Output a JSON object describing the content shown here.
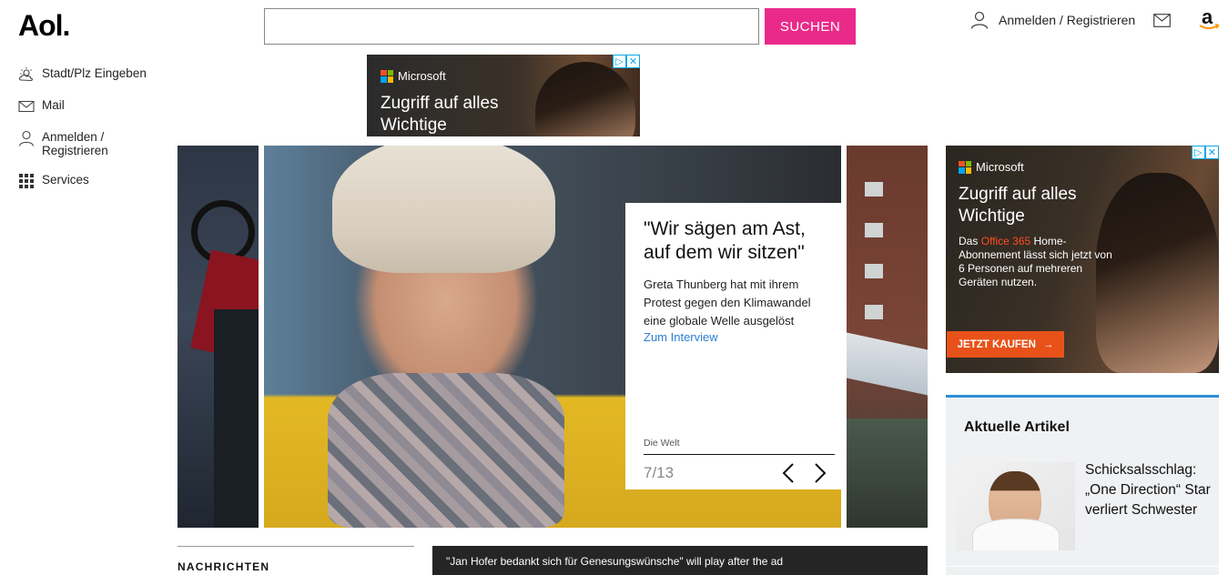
{
  "header": {
    "logo": "Aol.",
    "search": {
      "value": "",
      "button_label": "SUCHEN"
    },
    "login_label": "Anmelden / Registrieren",
    "icons": [
      "user-icon",
      "mail-icon",
      "amazon-icon"
    ]
  },
  "nav": {
    "items": [
      {
        "label": "Stadt/Plz Eingeben",
        "icon": "weather-icon"
      },
      {
        "label": "Mail",
        "icon": "mail-icon"
      },
      {
        "label": "Anmelden / Registrieren",
        "icon": "user-icon"
      },
      {
        "label": "Services",
        "icon": "grid-icon"
      }
    ]
  },
  "ad_top": {
    "brand": "Microsoft",
    "headline_line1": "Zugriff auf alles",
    "headline_line2": "Wichtige"
  },
  "carousel": {
    "title": "\"Wir sägen am Ast, auf dem wir sitzen\"",
    "text": "Greta Thunberg hat mit ihrem Protest gegen den Klimawandel eine globale Welle ausgelöst",
    "link": "Zum Interview",
    "source": "Die Welt",
    "position": "7/13"
  },
  "ad_right": {
    "brand": "Microsoft",
    "headline_line1": "Zugriff auf alles",
    "headline_line2": "Wichtige",
    "body_pre": "Das ",
    "body_highlight": "Office 365",
    "body_post": " Home-Abonnement lässt sich jetzt von 6 Personen auf mehreren Geräten nutzen.",
    "cta": "JETZT KAUFEN",
    "highlight_color": "#ff4b1f",
    "cta_color": "#e8521a"
  },
  "articles": {
    "title": "Aktuelle Artikel",
    "items": [
      {
        "text": "Schicksalsschlag: „One Direction“ Star verliert Schwester"
      }
    ]
  },
  "bottom": {
    "news_label": "NACHRICHTEN",
    "video_text": "\"Jan Hofer bedankt sich für Genesungswünsche\" will play after the ad"
  },
  "colors": {
    "search_button": "#ea2a8a",
    "link": "#2d7fd2",
    "articles_accent": "#2d8fd6"
  }
}
